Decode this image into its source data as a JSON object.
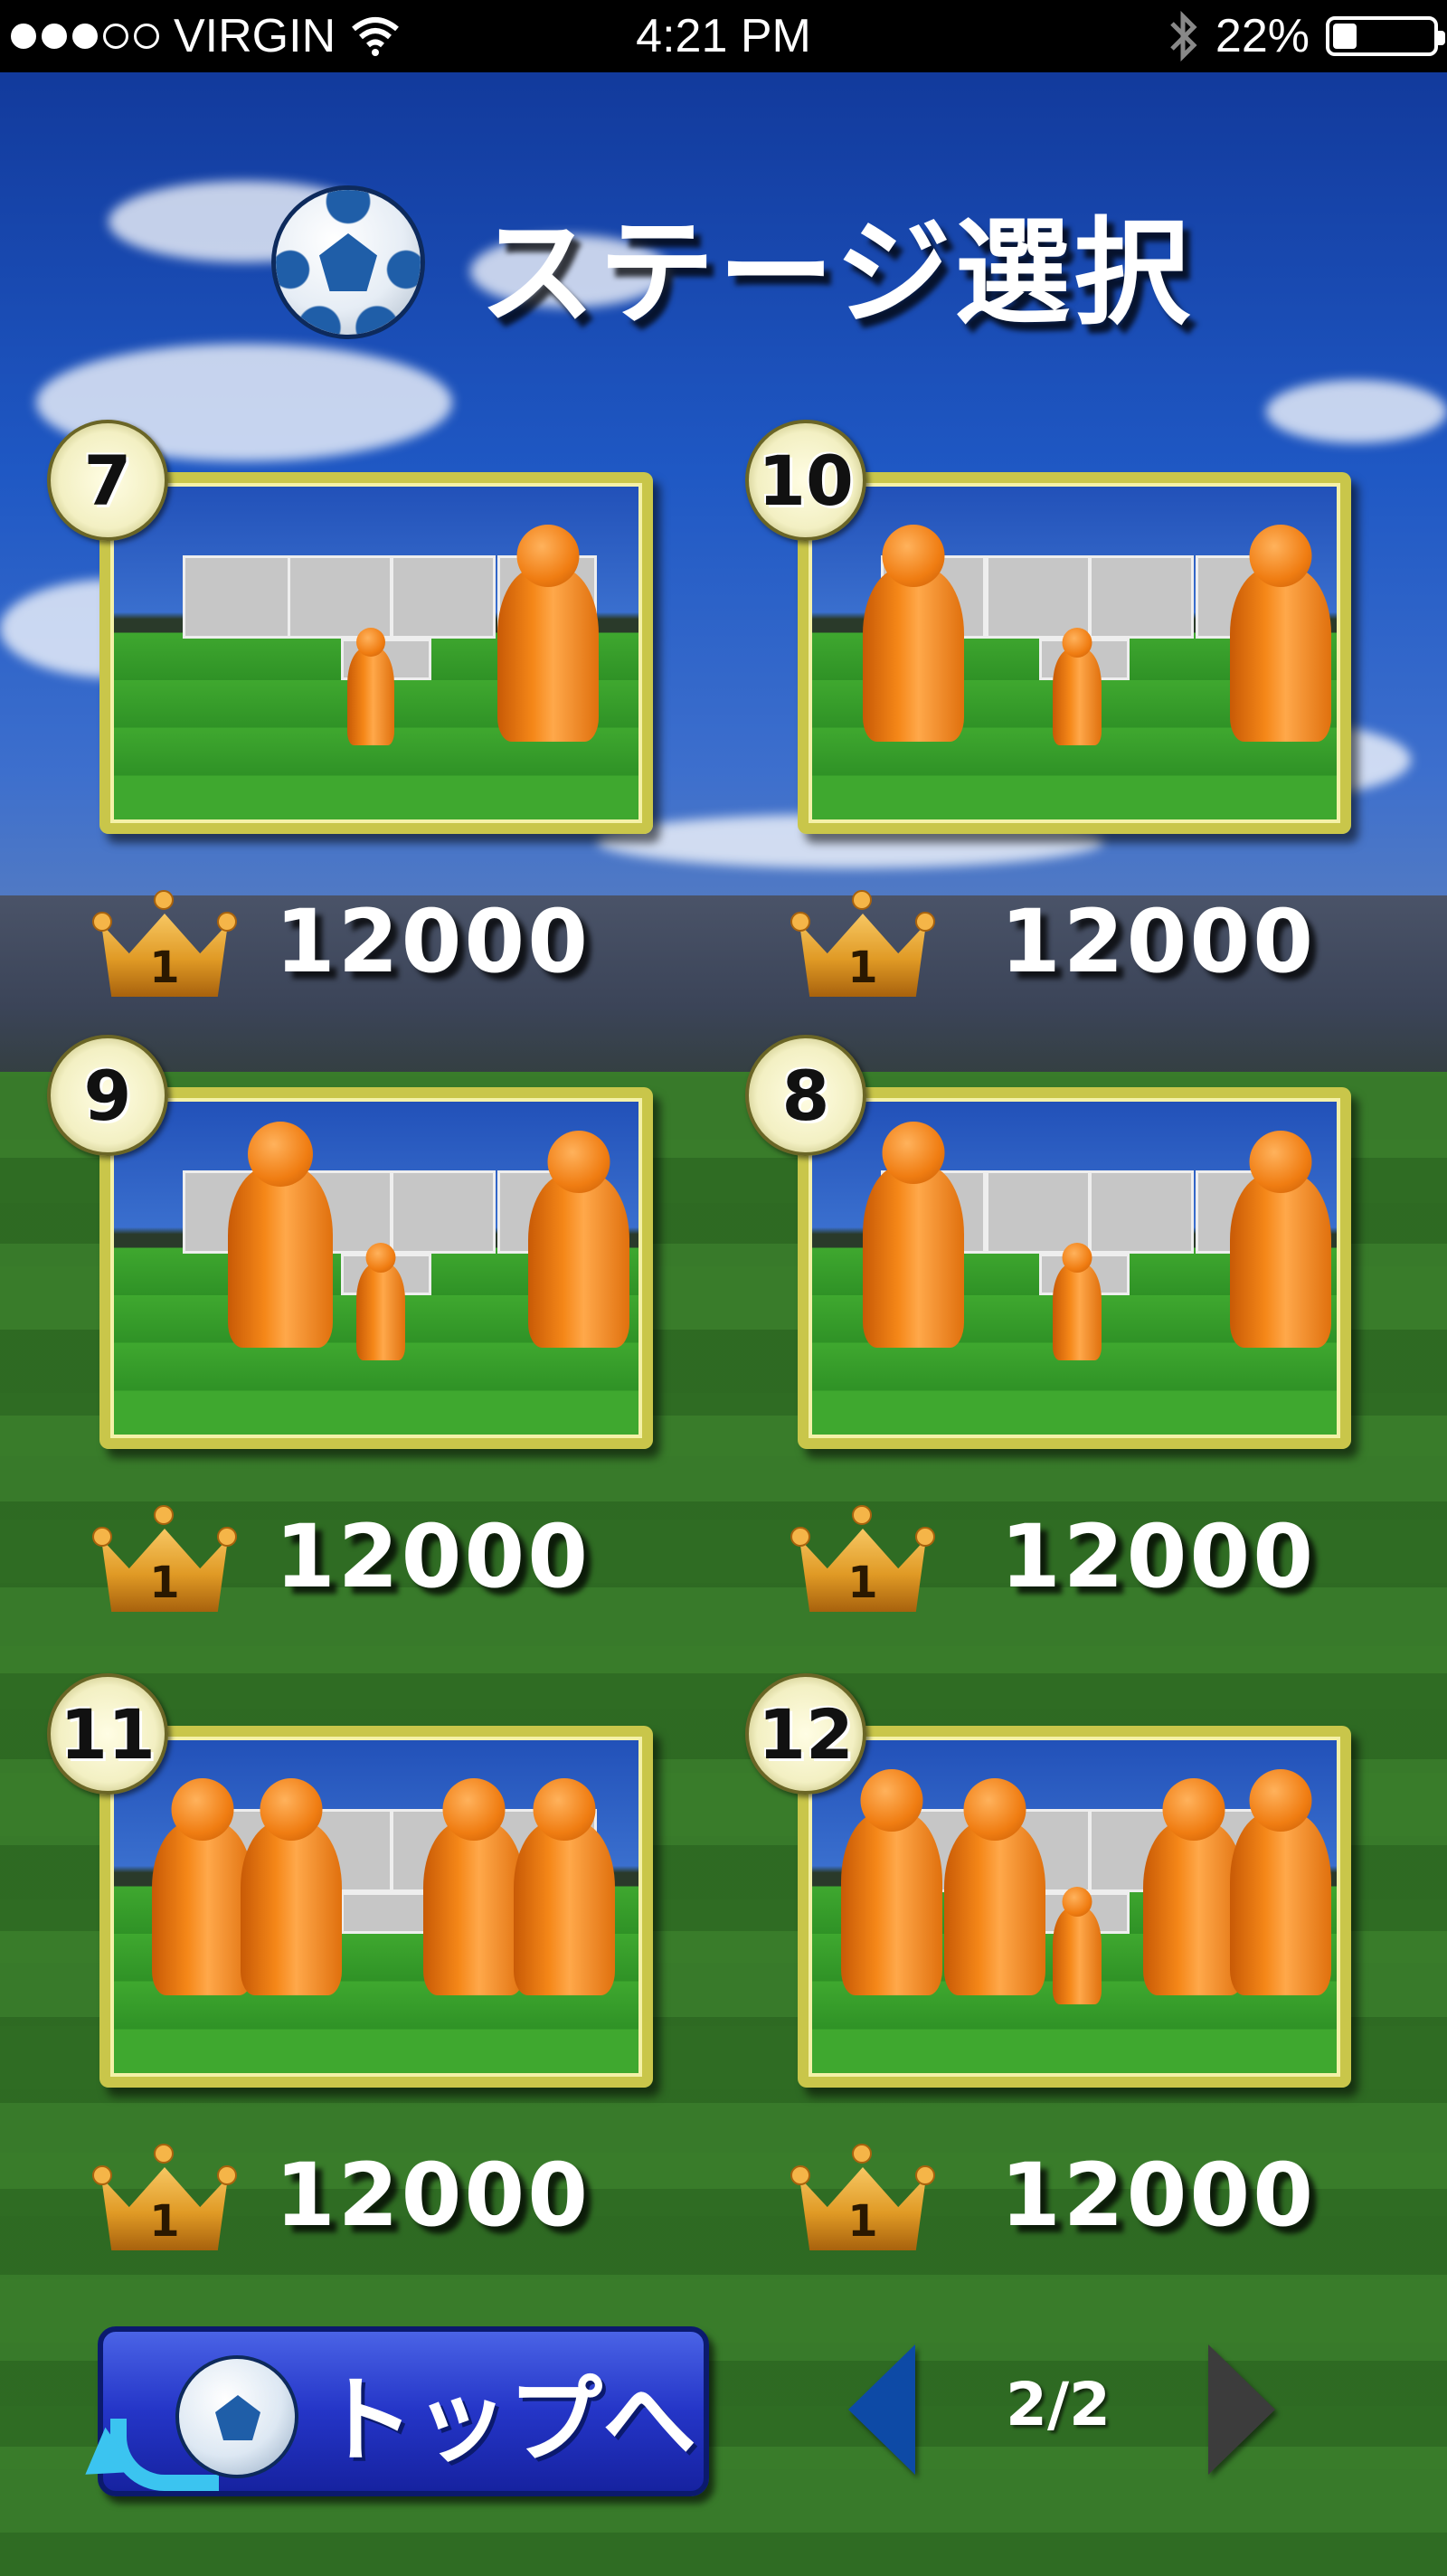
{
  "status_bar": {
    "carrier": "VIRGIN",
    "time": "4:21 PM",
    "battery": "22%",
    "battery_level": 0.22,
    "signal_bars_filled": 3,
    "signal_bars_total": 5,
    "icons": [
      "wifi-icon",
      "bluetooth-icon",
      "battery-icon"
    ]
  },
  "header": {
    "title": "ステージ選択",
    "icon": "soccer-ball-icon"
  },
  "stages": [
    {
      "number": "7",
      "rank": "1",
      "score": "12000"
    },
    {
      "number": "10",
      "rank": "1",
      "score": "12000"
    },
    {
      "number": "9",
      "rank": "1",
      "score": "12000"
    },
    {
      "number": "8",
      "rank": "1",
      "score": "12000"
    },
    {
      "number": "11",
      "rank": "1",
      "score": "12000"
    },
    {
      "number": "12",
      "rank": "1",
      "score": "12000"
    }
  ],
  "footer": {
    "top_button_label": "トップへ",
    "page_indicator": "2/2"
  },
  "colors": {
    "frame": "#c9c64a",
    "dummy": "#f58718",
    "button": "#2435c7",
    "prev_arrow": "#0d4aa6",
    "next_arrow": "#3c3c3c"
  }
}
